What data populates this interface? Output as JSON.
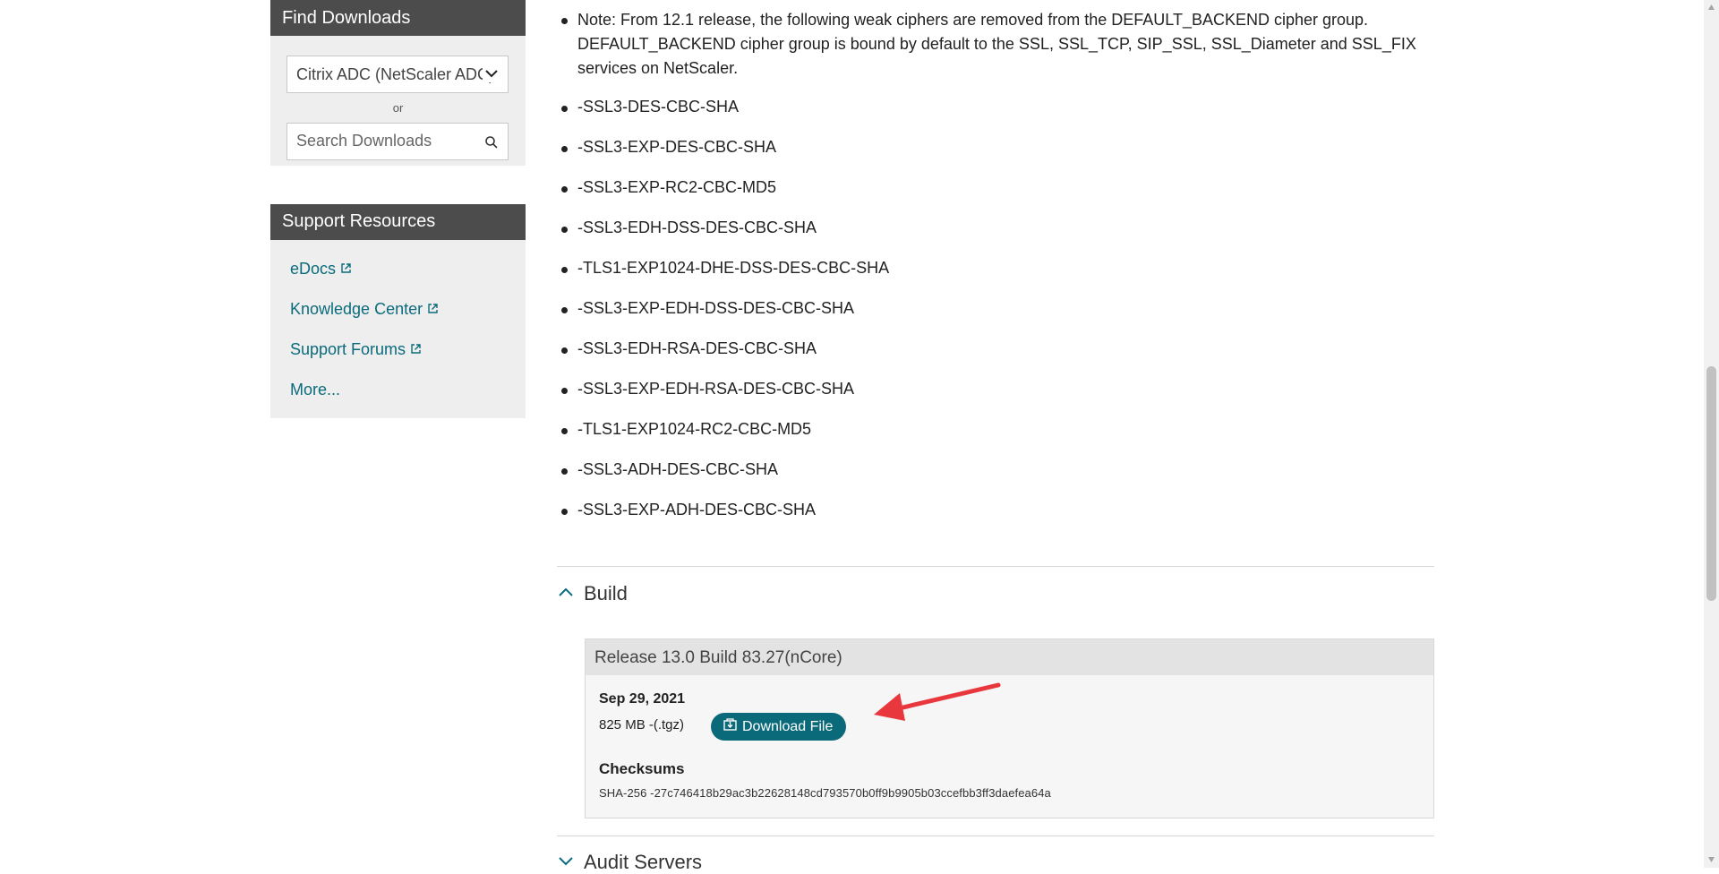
{
  "sidebar": {
    "find_downloads": {
      "title": "Find Downloads",
      "product_select_value": "Citrix ADC (NetScaler ADC)",
      "or_label": "or",
      "search_placeholder": "Search Downloads"
    },
    "support_resources": {
      "title": "Support Resources",
      "links": [
        "eDocs",
        "Knowledge Center",
        "Support Forums",
        "More..."
      ]
    }
  },
  "main": {
    "note_text": "Note: From 12.1 release, the following weak ciphers are removed from the DEFAULT_BACKEND cipher group. DEFAULT_BACKEND cipher group is bound by default to the SSL, SSL_TCP, SIP_SSL, SSL_Diameter and SSL_FIX services on NetScaler.",
    "ciphers": [
      "-SSL3-DES-CBC-SHA",
      "-SSL3-EXP-DES-CBC-SHA",
      "-SSL3-EXP-RC2-CBC-MD5",
      "-SSL3-EDH-DSS-DES-CBC-SHA",
      "-TLS1-EXP1024-DHE-DSS-DES-CBC-SHA",
      "-SSL3-EXP-EDH-DSS-DES-CBC-SHA",
      "-SSL3-EDH-RSA-DES-CBC-SHA",
      "-SSL3-EXP-EDH-RSA-DES-CBC-SHA",
      "-TLS1-EXP1024-RC2-CBC-MD5",
      "-SSL3-ADH-DES-CBC-SHA",
      "-SSL3-EXP-ADH-DES-CBC-SHA"
    ],
    "build_section": {
      "title": "Build",
      "release": {
        "title": "Release 13.0 Build 83.27(nCore)",
        "date": "Sep 29, 2021",
        "size": "825 MB -(.tgz)",
        "download_label": "Download File",
        "checksums_title": "Checksums",
        "checksum_value": "SHA-256 -27c746418b29ac3b22628148cd793570b0ff9b9905b03ccefbb3ff3daefea64a"
      }
    },
    "audit_section": {
      "title": "Audit Servers"
    }
  },
  "colors": {
    "accent": "#0b6a7a",
    "link": "#0a6b7c",
    "panel_header": "#4c4c4c",
    "panel_body": "#eeeeee",
    "annotation_arrow": "#e8383d"
  },
  "icons": [
    "chevron-down-icon",
    "search-icon",
    "external-link-icon",
    "chevron-up-icon",
    "download-icon"
  ]
}
